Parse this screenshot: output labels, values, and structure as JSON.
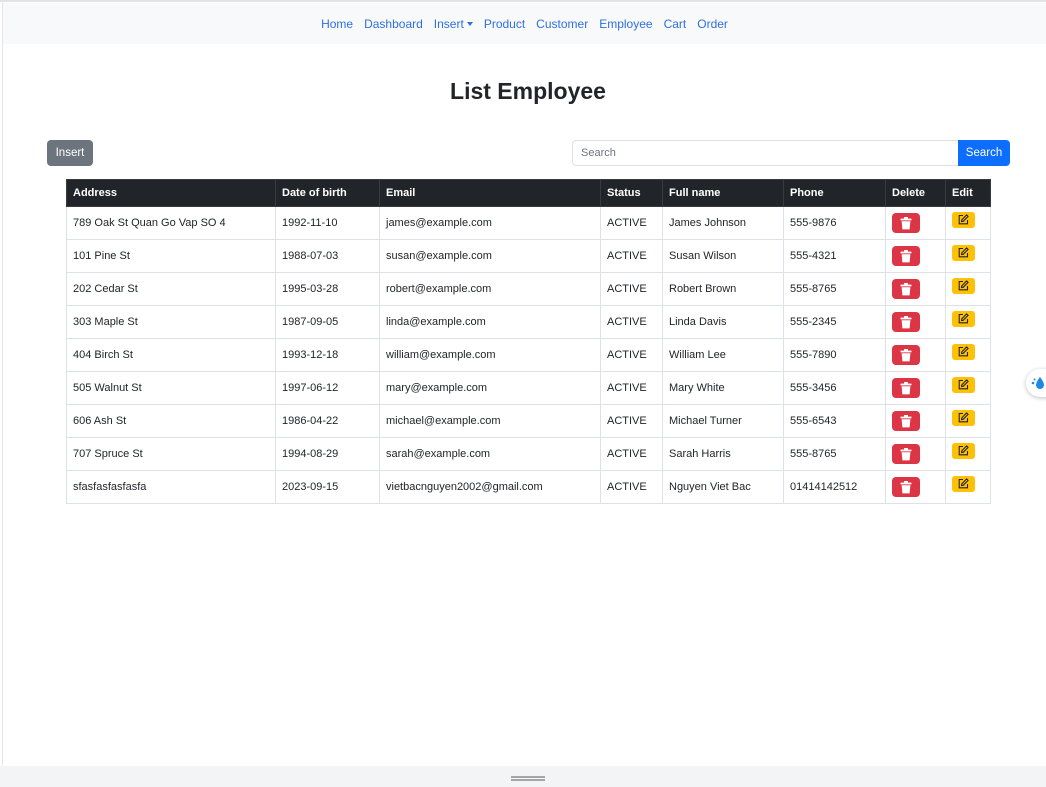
{
  "navbar": {
    "items": [
      {
        "label": "Home"
      },
      {
        "label": "Dashboard"
      },
      {
        "label": "Insert",
        "dropdown": true
      },
      {
        "label": "Product"
      },
      {
        "label": "Customer"
      },
      {
        "label": "Employee"
      },
      {
        "label": "Cart"
      },
      {
        "label": "Order"
      }
    ]
  },
  "page": {
    "title": "List Employee"
  },
  "toolbar": {
    "insert_label": "Insert",
    "search_placeholder": "Search",
    "search_value": "",
    "search_label": "Search"
  },
  "table": {
    "columns": [
      "Address",
      "Date of birth",
      "Email",
      "Status",
      "Full name",
      "Phone",
      "Delete",
      "Edit"
    ],
    "rows": [
      {
        "address": "789 Oak St Quan Go Vap SO 4",
        "dob": "1992-11-10",
        "email": "james@example.com",
        "status": "ACTIVE",
        "name": "James Johnson",
        "phone": "555-9876"
      },
      {
        "address": "101 Pine St",
        "dob": "1988-07-03",
        "email": "susan@example.com",
        "status": "ACTIVE",
        "name": "Susan Wilson",
        "phone": "555-4321"
      },
      {
        "address": "202 Cedar St",
        "dob": "1995-03-28",
        "email": "robert@example.com",
        "status": "ACTIVE",
        "name": "Robert Brown",
        "phone": "555-8765"
      },
      {
        "address": "303 Maple St",
        "dob": "1987-09-05",
        "email": "linda@example.com",
        "status": "ACTIVE",
        "name": "Linda Davis",
        "phone": "555-2345"
      },
      {
        "address": "404 Birch St",
        "dob": "1993-12-18",
        "email": "william@example.com",
        "status": "ACTIVE",
        "name": "William Lee",
        "phone": "555-7890"
      },
      {
        "address": "505 Walnut St",
        "dob": "1997-06-12",
        "email": "mary@example.com",
        "status": "ACTIVE",
        "name": "Mary White",
        "phone": "555-3456"
      },
      {
        "address": "606 Ash St",
        "dob": "1986-04-22",
        "email": "michael@example.com",
        "status": "ACTIVE",
        "name": "Michael Turner",
        "phone": "555-6543"
      },
      {
        "address": "707 Spruce St",
        "dob": "1994-08-29",
        "email": "sarah@example.com",
        "status": "ACTIVE",
        "name": "Sarah Harris",
        "phone": "555-8765"
      },
      {
        "address": "sfasfasfasfasfa",
        "dob": "2023-09-15",
        "email": "vietbacnguyen2002@gmail.com",
        "status": "ACTIVE",
        "name": "Nguyen Viet Bac",
        "phone": "01414142512"
      }
    ]
  },
  "icons": {
    "delete": "trash-icon",
    "edit": "edit-icon",
    "floating": "droplet-icon"
  },
  "colors": {
    "link": "#2f6fe0",
    "header_bg": "#212529",
    "delete_button": "#dc3545",
    "edit_button": "#ffc107",
    "search_button": "#0d6efd",
    "insert_button": "#6c757d"
  }
}
